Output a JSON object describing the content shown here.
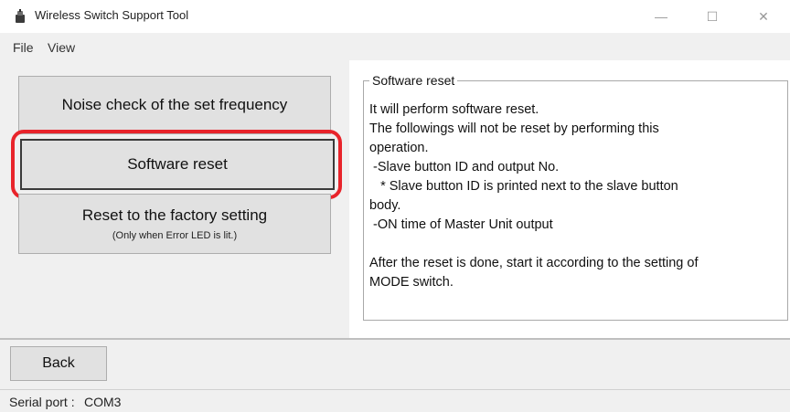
{
  "window": {
    "title": "Wireless Switch Support Tool",
    "app_icon": "wireless-switch-icon",
    "minimize_glyph": "—",
    "maximize_glyph": "☐",
    "close_glyph": "✕"
  },
  "menu": {
    "items": [
      {
        "label": "File"
      },
      {
        "label": "View"
      }
    ]
  },
  "actions": {
    "noise_check": "Noise check of the set frequency",
    "software_reset": "Software reset",
    "factory_reset": "Reset to the factory setting",
    "factory_reset_note": "(Only when Error LED is lit.)"
  },
  "description": {
    "title": "Software reset",
    "lines": [
      "It will perform software reset.",
      "The followings will not be reset by performing this",
      "operation.",
      " -Slave button ID and output No.",
      "   * Slave button ID is printed next to the slave button",
      "body.",
      " -ON time of Master Unit output",
      "",
      "After the reset is done, start it according to the setting of",
      "MODE switch."
    ]
  },
  "footer": {
    "back_label": "Back"
  },
  "status": {
    "label": "Serial port :",
    "value": "COM3"
  },
  "colors": {
    "highlight": "#e8242b",
    "panel_bg": "#f0f0f0",
    "button_bg": "#e1e1e1"
  }
}
